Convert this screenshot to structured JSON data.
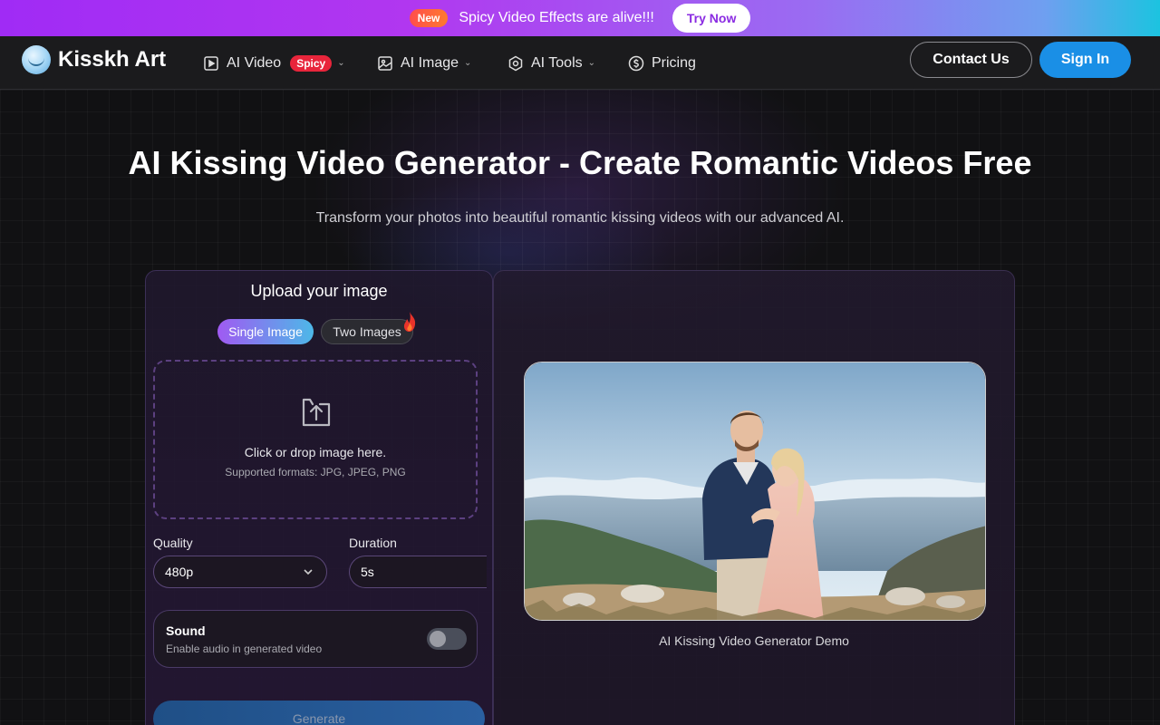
{
  "announcement": {
    "badge": "New",
    "text": "Spicy Video Effects are alive!!!",
    "cta": "Try Now"
  },
  "nav": {
    "brand": "Kisskh Art",
    "items": [
      {
        "label": "AI Video",
        "icon": "play-square-icon",
        "badge": "Spicy",
        "has_dropdown": true
      },
      {
        "label": "AI Image",
        "icon": "image-icon",
        "has_dropdown": true
      },
      {
        "label": "AI Tools",
        "icon": "hexagon-icon",
        "has_dropdown": true
      },
      {
        "label": "Pricing",
        "icon": "dollar-circle-icon",
        "has_dropdown": false
      }
    ],
    "contact": "Contact Us",
    "signin": "Sign In"
  },
  "hero": {
    "title": "AI Kissing Video Generator - Create Romantic Videos Free",
    "subtitle": "Transform your photos into beautiful romantic kissing videos with our advanced AI."
  },
  "upload": {
    "title": "Upload your image",
    "modes": [
      "Single Image",
      "Two Images"
    ],
    "selected_mode": "Single Image",
    "drop_text": "Click or drop image here.",
    "formats": "Supported formats: JPG, JPEG, PNG",
    "quality_label": "Quality",
    "quality_value": "480p",
    "duration_label": "Duration",
    "duration_value": "5s",
    "sound_title": "Sound",
    "sound_desc": "Enable audio in generated video",
    "sound_enabled": false,
    "generate": "Generate"
  },
  "preview": {
    "caption": "AI Kissing Video Generator Demo"
  },
  "colors": {
    "accent_purple": "#a02bf5",
    "accent_blue": "#1a8fe6",
    "spicy_red": "#e8253b"
  }
}
